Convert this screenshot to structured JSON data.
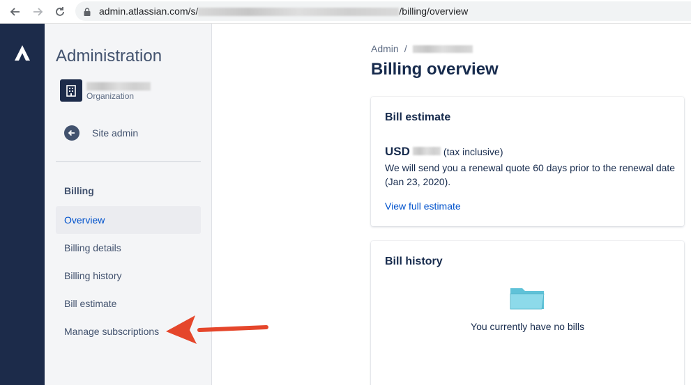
{
  "browser": {
    "url_host": "admin.atlassian.com/s/",
    "url_path": "/billing/overview",
    "icons": [
      "back-arrow-icon",
      "forward-arrow-icon",
      "reload-icon",
      "lock-icon"
    ]
  },
  "rail": {
    "logo": "atlassian-logo-icon",
    "color": "#1c2b4a"
  },
  "sidebar": {
    "title": "Administration",
    "org_type": "Organization",
    "back_label": "Site admin",
    "section_label": "Billing",
    "items": [
      {
        "label": "Overview",
        "active": true
      },
      {
        "label": "Billing details",
        "active": false
      },
      {
        "label": "Billing history",
        "active": false
      },
      {
        "label": "Bill estimate",
        "active": false
      },
      {
        "label": "Manage subscriptions",
        "active": false
      }
    ]
  },
  "main": {
    "breadcrumb_root": "Admin",
    "breadcrumb_sep": "/",
    "title": "Billing overview",
    "estimate_card": {
      "title": "Bill estimate",
      "currency": "USD",
      "tax_note": "(tax inclusive)",
      "renewal_text": "We will send you a renewal quote 60 days prior to the renewal date (Jan 23, 2020).",
      "link_label": "View full estimate"
    },
    "history_card": {
      "title": "Bill history",
      "empty_text": "You currently have no bills"
    }
  },
  "colors": {
    "link": "#0052cc",
    "text_primary": "#172b4d",
    "text_secondary": "#42526e",
    "annotation_arrow": "#e5462b"
  }
}
